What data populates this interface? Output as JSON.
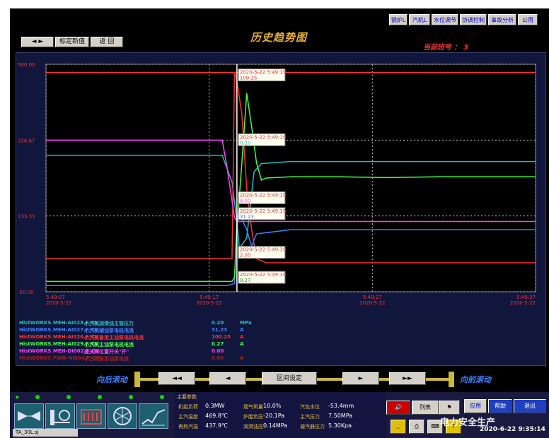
{
  "nav": [
    {
      "label": "锅炉L",
      "name": "nav-boiler"
    },
    {
      "label": "汽机L",
      "name": "nav-turbine"
    },
    {
      "label": "水位调节",
      "name": "nav-water-level"
    },
    {
      "label": "协调控制",
      "name": "nav-coordination"
    },
    {
      "label": "事故分析",
      "name": "nav-accident"
    },
    {
      "label": "公用",
      "name": "nav-common"
    }
  ],
  "toolbar": {
    "arrows": "◄ ►",
    "calibrate": "标定新值",
    "back": "返 回"
  },
  "title": "历史趋势图",
  "shift": "当前班号 ：  3",
  "chart_data": {
    "type": "line",
    "y_ticks": [
      "500.00",
      "316.67",
      "133.33",
      "-50.00"
    ],
    "ylim": [
      -50,
      500
    ],
    "x_ticks": [
      {
        "time": "5:49:07",
        "date": "2020-5-22"
      },
      {
        "time": "5:49:17",
        "date": "2020-5-22"
      },
      {
        "time": "5:49:27",
        "date": "2020-5-22"
      },
      {
        "time": "5:49:37",
        "date": "2020-5-22"
      }
    ],
    "series": [
      {
        "name": "HistWORKS.MEH-AI028.F_CV",
        "color": "#20c0c0",
        "values": [
          [
            0,
            280
          ],
          [
            0.36,
            280
          ],
          [
            0.38,
            215
          ],
          [
            0.39,
            120
          ],
          [
            0.395,
            55
          ],
          [
            0.41,
            80
          ],
          [
            0.425,
            240
          ],
          [
            0.44,
            260
          ],
          [
            0.5,
            265
          ],
          [
            0.55,
            265
          ],
          [
            1,
            265
          ]
        ]
      },
      {
        "name": "HistWORKS.MEH-AI027.F_CV",
        "color": "#4080ff",
        "values": [
          [
            0,
            -35
          ],
          [
            0.37,
            -35
          ],
          [
            0.385,
            -30
          ],
          [
            0.39,
            130
          ],
          [
            0.395,
            140
          ],
          [
            0.41,
            100
          ],
          [
            0.42,
            60
          ],
          [
            0.43,
            90
          ],
          [
            0.5,
            100
          ],
          [
            1,
            100
          ]
        ]
      },
      {
        "name": "HistWORKS.MEH-AI026.F_CV",
        "color": "#ff3030",
        "values": [
          [
            0,
            30
          ],
          [
            0.38,
            30
          ],
          [
            0.385,
            480
          ],
          [
            0.39,
            460
          ],
          [
            0.4,
            380
          ],
          [
            0.41,
            200
          ],
          [
            0.42,
            100
          ],
          [
            0.43,
            30
          ],
          [
            0.45,
            20
          ],
          [
            1,
            20
          ]
        ]
      },
      {
        "name": "HistWORKS.MEH-AI029.F_CV",
        "color": "#40ff40",
        "values": [
          [
            0,
            -25
          ],
          [
            0.38,
            -25
          ],
          [
            0.385,
            -15
          ],
          [
            0.39,
            100
          ],
          [
            0.4,
            260
          ],
          [
            0.41,
            430
          ],
          [
            0.42,
            350
          ],
          [
            0.43,
            262
          ],
          [
            0.44,
            220
          ],
          [
            0.45,
            225
          ],
          [
            0.5,
            228
          ],
          [
            0.6,
            228
          ],
          [
            0.7,
            226
          ],
          [
            0.8,
            228
          ],
          [
            1,
            228
          ]
        ]
      },
      {
        "name": "HistWORKS.MEH-DI002.F_CV",
        "color": "#ff40ff",
        "values": [
          [
            0,
            316.67
          ],
          [
            0.36,
            316.67
          ],
          [
            0.37,
            250
          ],
          [
            0.385,
            130
          ],
          [
            0.39,
            120
          ],
          [
            1,
            120
          ]
        ]
      },
      {
        "name": "HistWORKS.FWO-NI004.F_CV",
        "color": "#ff3030",
        "values": [
          [
            0,
            480
          ],
          [
            0.38,
            480
          ],
          [
            0.385,
            480
          ],
          [
            1,
            480
          ]
        ]
      }
    ],
    "cursor": {
      "x": 0.39,
      "time": "2020-5-22 5:49:19"
    },
    "tooltips": [
      {
        "time": "2020-5-22 5:49:19",
        "value": "100.25",
        "color": "#ff3030",
        "y": 0.07
      },
      {
        "time": "2020-5-22 5:49:19",
        "value": "0.20",
        "color": "#20c0c0",
        "y": 0.355
      },
      {
        "time": "2020-5-22 5:49:19",
        "value": "0.00",
        "color": "#ff40ff",
        "y": 0.61
      },
      {
        "time": "2020-5-22 5:49:19",
        "value": "31.23",
        "color": "#4080ff",
        "y": 0.68
      },
      {
        "time": "2020-5-22 5:49:19",
        "value": "2.00",
        "color": "#ff3030",
        "y": 0.85
      },
      {
        "time": "2020-5-22 5:49:19",
        "value": "0.27",
        "color": "#40ff40",
        "y": 0.96
      }
    ],
    "legend": [
      {
        "tag": "HistWORKS.MEH-AI028.F_CV",
        "desc": "小汽机润滑油主管压力",
        "value": "0.20",
        "unit": "MPa",
        "color": "#20c0c0"
      },
      {
        "tag": "HistWORKS.MEH-AI027.F_CV",
        "desc": "小汽机辅油泵电机电流",
        "value": "31.23",
        "unit": "A",
        "color": "#4080ff"
      },
      {
        "tag": "HistWORKS.MEH-AI026.F_CV",
        "desc": "小汽机备用主油泵电机电流",
        "value": "100.25",
        "unit": "A",
        "color": "#ff3030"
      },
      {
        "tag": "HistWORKS.MEH-AI029.F_CV",
        "desc": "小汽机主油泵电机电流",
        "value": "0.27",
        "unit": "A",
        "color": "#40ff40"
      },
      {
        "tag": "HistWORKS.MEH-DI002.F_CV",
        "desc": "速关阀位置开关\"开\"",
        "value": "0.00",
        "unit": "",
        "color": "#ff40ff"
      },
      {
        "tag": "HistWORKS.FWO-NI004.F_CV",
        "desc": "小汽机备用油泵电流",
        "value": "0.00",
        "unit": "A",
        "color": "#a02020"
      }
    ]
  },
  "scroll": {
    "back": "向后滚动",
    "forward": "向前滚动",
    "fast_back": "◄◄",
    "step_back": "◄",
    "range": "区间设定",
    "step_fwd": "►",
    "fast_fwd": "►►"
  },
  "params": {
    "title": "主要参数",
    "rows": [
      [
        {
          "label": "机组负荷",
          "value": "0.3MW"
        },
        {
          "label": "烟气氧量",
          "value": "10.0%"
        },
        {
          "label": "汽包水位",
          "value": "-53.4mm"
        }
      ],
      [
        {
          "label": "主汽温度",
          "value": "469.8℃"
        },
        {
          "label": "炉膛负压",
          "value": "-20.1Pa"
        },
        {
          "label": "主汽压力",
          "value": "7.50MPa"
        }
      ],
      [
        {
          "label": "再热汽温",
          "value": "437.9℃"
        },
        {
          "label": "润滑油压",
          "value": "0.14MPa"
        },
        {
          "label": "凝汽器压力",
          "value": "5.30Kpa"
        }
      ]
    ]
  },
  "taskbar": {
    "label": "TA_30L.sj"
  },
  "right": {
    "list": "列表",
    "apply": "应用",
    "help": "帮助",
    "exit": "退出"
  },
  "watermark": "电力安全生产",
  "datetime": "2020-6-22  9:35:14"
}
